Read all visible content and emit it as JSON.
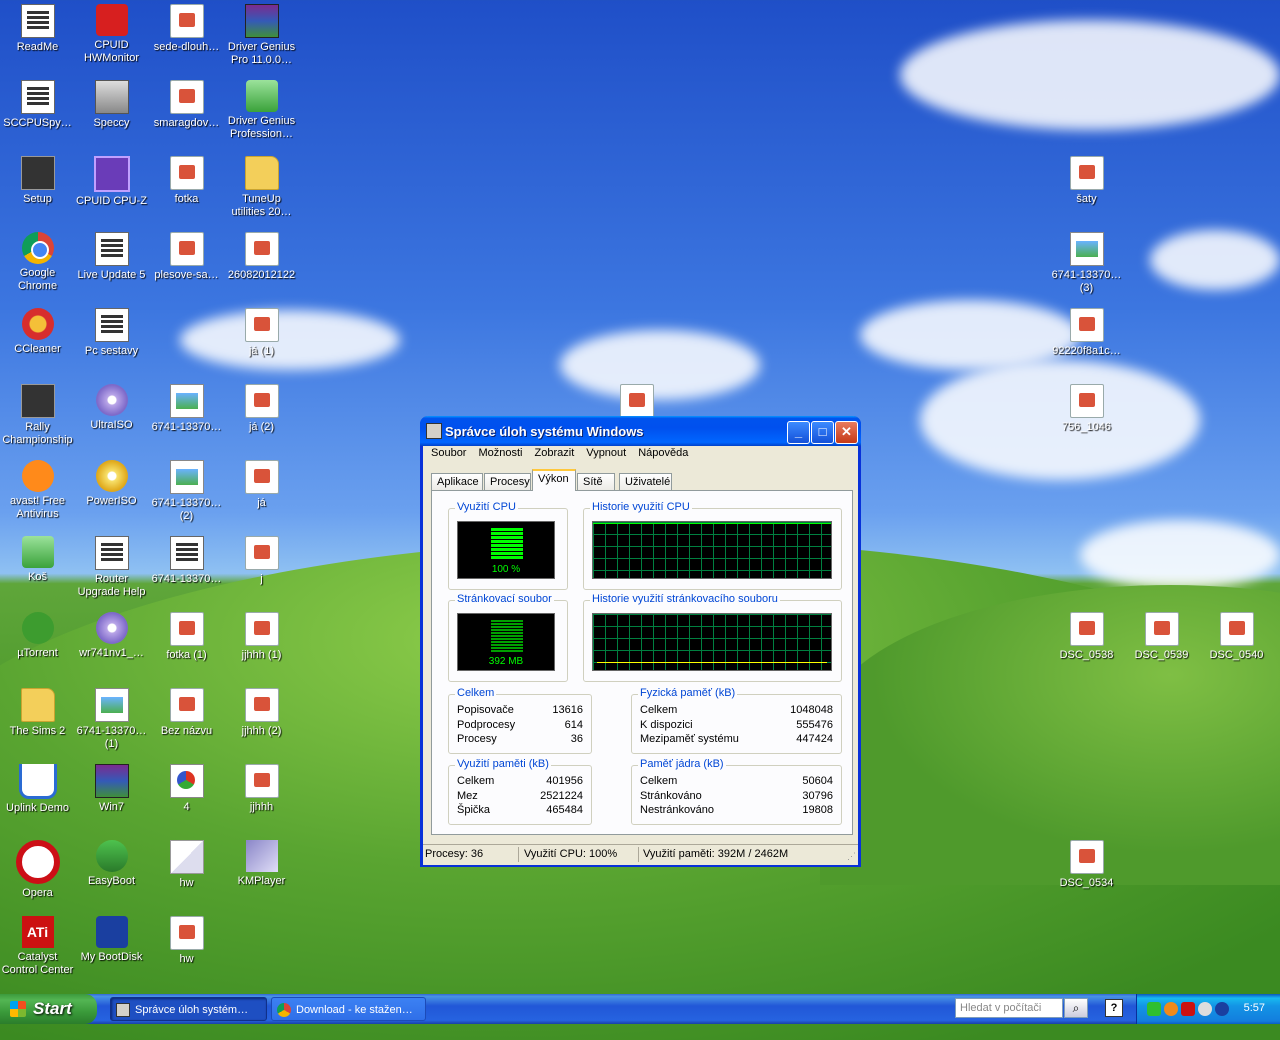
{
  "desktop_icons": {
    "c1": [
      {
        "label": "ReadMe"
      },
      {
        "label": "SCCPUSpy…"
      },
      {
        "label": "Setup"
      },
      {
        "label": "Google Chrome"
      },
      {
        "label": "CCleaner"
      },
      {
        "label": "Rally Championship"
      },
      {
        "label": "avast! Free Antivirus"
      },
      {
        "label": "Koš"
      },
      {
        "label": "µTorrent"
      },
      {
        "label": "The Sims 2"
      },
      {
        "label": "Uplink Demo"
      },
      {
        "label": "Opera"
      },
      {
        "label": "Catalyst Control Center"
      }
    ],
    "c2": [
      {
        "label": "CPUID HWMonitor"
      },
      {
        "label": "Speccy"
      },
      {
        "label": "CPUID CPU-Z"
      },
      {
        "label": "Live Update 5"
      },
      {
        "label": "Pc sestavy"
      },
      {
        "label": "UltraISO"
      },
      {
        "label": "PowerISO"
      },
      {
        "label": "Router Upgrade Help"
      },
      {
        "label": "wr741nv1_…"
      },
      {
        "label": "6741-13370… (1)"
      },
      {
        "label": "Win7"
      },
      {
        "label": "EasyBoot"
      },
      {
        "label": "My BootDisk"
      }
    ],
    "c3": [
      {
        "label": "sede-dlouh…"
      },
      {
        "label": "smaragdov…"
      },
      {
        "label": "fotka"
      },
      {
        "label": "plesove-sa…"
      },
      {
        "label": "6741-13370…"
      },
      {
        "label": "6741-13370… (2)"
      },
      {
        "label": "6741-13370…"
      },
      {
        "label": "fotka (1)"
      },
      {
        "label": "Bez názvu"
      },
      {
        "label": "4"
      },
      {
        "label": "hw"
      },
      {
        "label": "hw"
      }
    ],
    "c4": [
      {
        "label": "Driver Genius Pro 11.0.0…"
      },
      {
        "label": "Driver Genius Profession…"
      },
      {
        "label": "TuneUp utilities 20…"
      },
      {
        "label": "26082012122"
      },
      {
        "label": "já (1)"
      },
      {
        "label": "já (2)"
      },
      {
        "label": "já"
      },
      {
        "label": "j"
      },
      {
        "label": "jjhhh (1)"
      },
      {
        "label": "jjhhh (2)"
      },
      {
        "label": "jjhhh"
      },
      {
        "label": "KMPlayer"
      }
    ],
    "right": [
      {
        "label": "šaty"
      },
      {
        "label": "6741-13370… (3)"
      },
      {
        "label": "92220f8a1c…"
      },
      {
        "label": "756_1046"
      },
      {
        "label": "DSC_0538"
      },
      {
        "label": "DSC_0539"
      },
      {
        "label": "DSC_0540"
      },
      {
        "label": "DSC_0534"
      },
      {
        "label": ""
      }
    ]
  },
  "window": {
    "title": "Správce úloh systému Windows",
    "buttons": {
      "minimize": "_",
      "maximize": "□",
      "close": "✕"
    },
    "menu": [
      "Soubor",
      "Možnosti",
      "Zobrazit",
      "Vypnout",
      "Nápověda"
    ],
    "tabs": [
      "Aplikace",
      "Procesy",
      "Výkon",
      "Sítě",
      "Uživatelé"
    ],
    "active_tab": "Výkon",
    "cpu_usage": {
      "title": "Využití CPU",
      "value": "100 %",
      "level": 1.0
    },
    "cpu_history": {
      "title": "Historie využití CPU"
    },
    "pagefile": {
      "title": "Stránkovací soubor",
      "value": "392 MB"
    },
    "pagefile_history": {
      "title": "Historie využití stránkovacího souboru"
    },
    "totals": {
      "title": "Celkem",
      "rows": [
        {
          "k": "Popisovače",
          "v": "13616"
        },
        {
          "k": "Podprocesy",
          "v": "614"
        },
        {
          "k": "Procesy",
          "v": "36"
        }
      ]
    },
    "physical": {
      "title": "Fyzická paměť (kB)",
      "rows": [
        {
          "k": "Celkem",
          "v": "1048048"
        },
        {
          "k": "K dispozici",
          "v": "555476"
        },
        {
          "k": "Mezipaměť systému",
          "v": "447424"
        }
      ]
    },
    "commit": {
      "title": "Využití paměti (kB)",
      "rows": [
        {
          "k": "Celkem",
          "v": "401956"
        },
        {
          "k": "Mez",
          "v": "2521224"
        },
        {
          "k": "Špička",
          "v": "465484"
        }
      ]
    },
    "kernel": {
      "title": "Paměť jádra (kB)",
      "rows": [
        {
          "k": "Celkem",
          "v": "50604"
        },
        {
          "k": "Stránkováno",
          "v": "30796"
        },
        {
          "k": "Nestránkováno",
          "v": "19808"
        }
      ]
    },
    "status": {
      "processes": "Procesy: 36",
      "cpu": "Využití CPU: 100%",
      "memory": "Využití paměti: 392M / 2462M"
    }
  },
  "taskbar": {
    "start": "Start",
    "tasks": [
      {
        "label": "Správce úloh systém…"
      },
      {
        "label": "Download - ke stažen…"
      }
    ],
    "search_placeholder": "Hledat v počítači",
    "help": "?",
    "clock": "5:57"
  }
}
